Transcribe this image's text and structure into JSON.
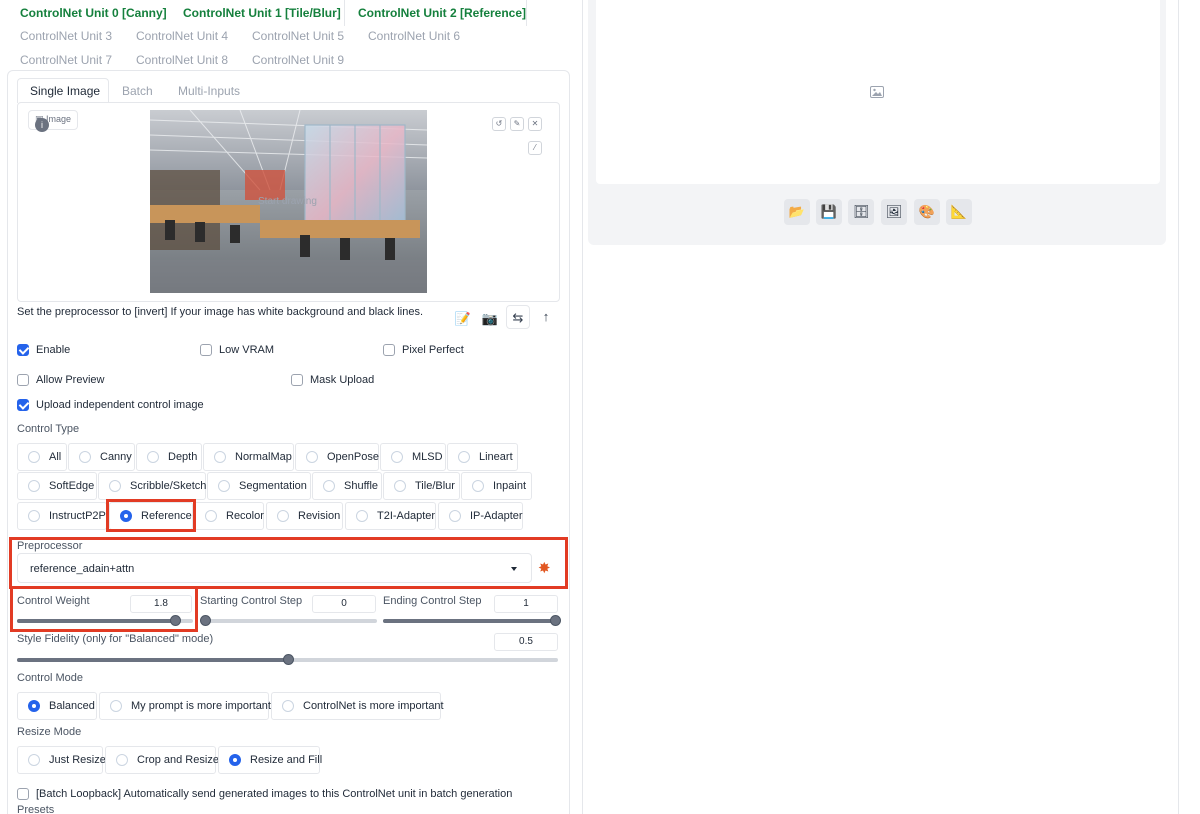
{
  "unit_tabs": {
    "row1": [
      "ControlNet Unit 0 [Canny]",
      "ControlNet Unit 1 [Tile/Blur]",
      "ControlNet Unit 2 [Reference]"
    ],
    "row2": [
      "ControlNet Unit 3",
      "ControlNet Unit 4",
      "ControlNet Unit 5",
      "ControlNet Unit 6"
    ],
    "row3": [
      "ControlNet Unit 7",
      "ControlNet Unit 8",
      "ControlNet Unit 9"
    ]
  },
  "input_tabs": [
    "Single Image",
    "Batch",
    "Multi-Inputs"
  ],
  "image_panel": {
    "label": "Image",
    "overlay_text": "Start drawing"
  },
  "hint_text": "Set the preprocessor to [invert] If your image has white background and black lines.",
  "checkboxes": {
    "enable": "Enable",
    "low_vram": "Low VRAM",
    "pixel_perfect": "Pixel Perfect",
    "allow_preview": "Allow Preview",
    "mask_upload": "Mask Upload",
    "upload_independent": "Upload independent control image"
  },
  "control_type": {
    "label": "Control Type",
    "options": [
      "All",
      "Canny",
      "Depth",
      "NormalMap",
      "OpenPose",
      "MLSD",
      "Lineart",
      "SoftEdge",
      "Scribble/Sketch",
      "Segmentation",
      "Shuffle",
      "Tile/Blur",
      "Inpaint",
      "InstructP2P",
      "Reference",
      "Recolor",
      "Revision",
      "T2I-Adapter",
      "IP-Adapter"
    ],
    "selected": "Reference"
  },
  "preprocessor": {
    "label": "Preprocessor",
    "value": "reference_adain+attn"
  },
  "sliders": {
    "control_weight": {
      "label": "Control Weight",
      "value": "1.8",
      "fraction": 0.9
    },
    "starting_step": {
      "label": "Starting Control Step",
      "value": "0",
      "fraction": 0.0
    },
    "ending_step": {
      "label": "Ending Control Step",
      "value": "1",
      "fraction": 1.0
    },
    "style_fidelity": {
      "label": "Style Fidelity (only for \"Balanced\" mode)",
      "value": "0.5",
      "fraction": 0.5
    }
  },
  "control_mode": {
    "label": "Control Mode",
    "options": [
      "Balanced",
      "My prompt is more important",
      "ControlNet is more important"
    ],
    "selected": "Balanced"
  },
  "resize_mode": {
    "label": "Resize Mode",
    "options": [
      "Just Resize",
      "Crop and Resize",
      "Resize and Fill"
    ],
    "selected": "Resize and Fill"
  },
  "batch_loopback": "[Batch Loopback] Automatically send generated images to this ControlNet unit in batch generation",
  "presets_label": "Presets",
  "colors": {
    "accent": "#2563eb",
    "unit_green": "#15803d",
    "highlight": "#e23b24"
  },
  "right_toolbar_icons": [
    "folder-icon",
    "save-icon",
    "archive-icon",
    "image-icon",
    "palette-icon",
    "ruler-icon"
  ]
}
